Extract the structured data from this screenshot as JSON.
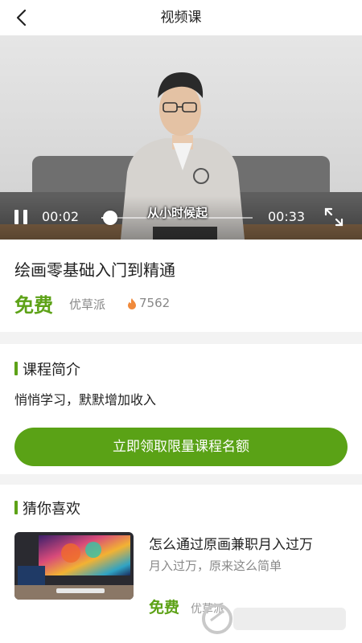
{
  "header": {
    "title": "视频课",
    "back_icon": "chevron-left-icon"
  },
  "player": {
    "current_time": "00:02",
    "total_time": "00:33",
    "progress_fraction": 0.06,
    "subtitle": "从小时候起",
    "pause_icon": "pause-icon",
    "fullscreen_icon": "fullscreen-icon"
  },
  "course": {
    "title": "绘画零基础入门到精通",
    "price": "免费",
    "provider": "优草派",
    "hot_icon": "flame-icon",
    "views": "7562"
  },
  "intro": {
    "heading": "课程简介",
    "text": "悄悄学习，默默增加收入"
  },
  "cta": {
    "label": "立即领取限量课程名额"
  },
  "recommend": {
    "heading": "猜你喜欢",
    "items": [
      {
        "title": "怎么通过原画兼职月入过万",
        "desc": "月入过万，原来这么简单",
        "price": "免费",
        "provider": "优草派"
      }
    ]
  },
  "colors": {
    "accent": "#5da217",
    "button": "#5aa216"
  }
}
